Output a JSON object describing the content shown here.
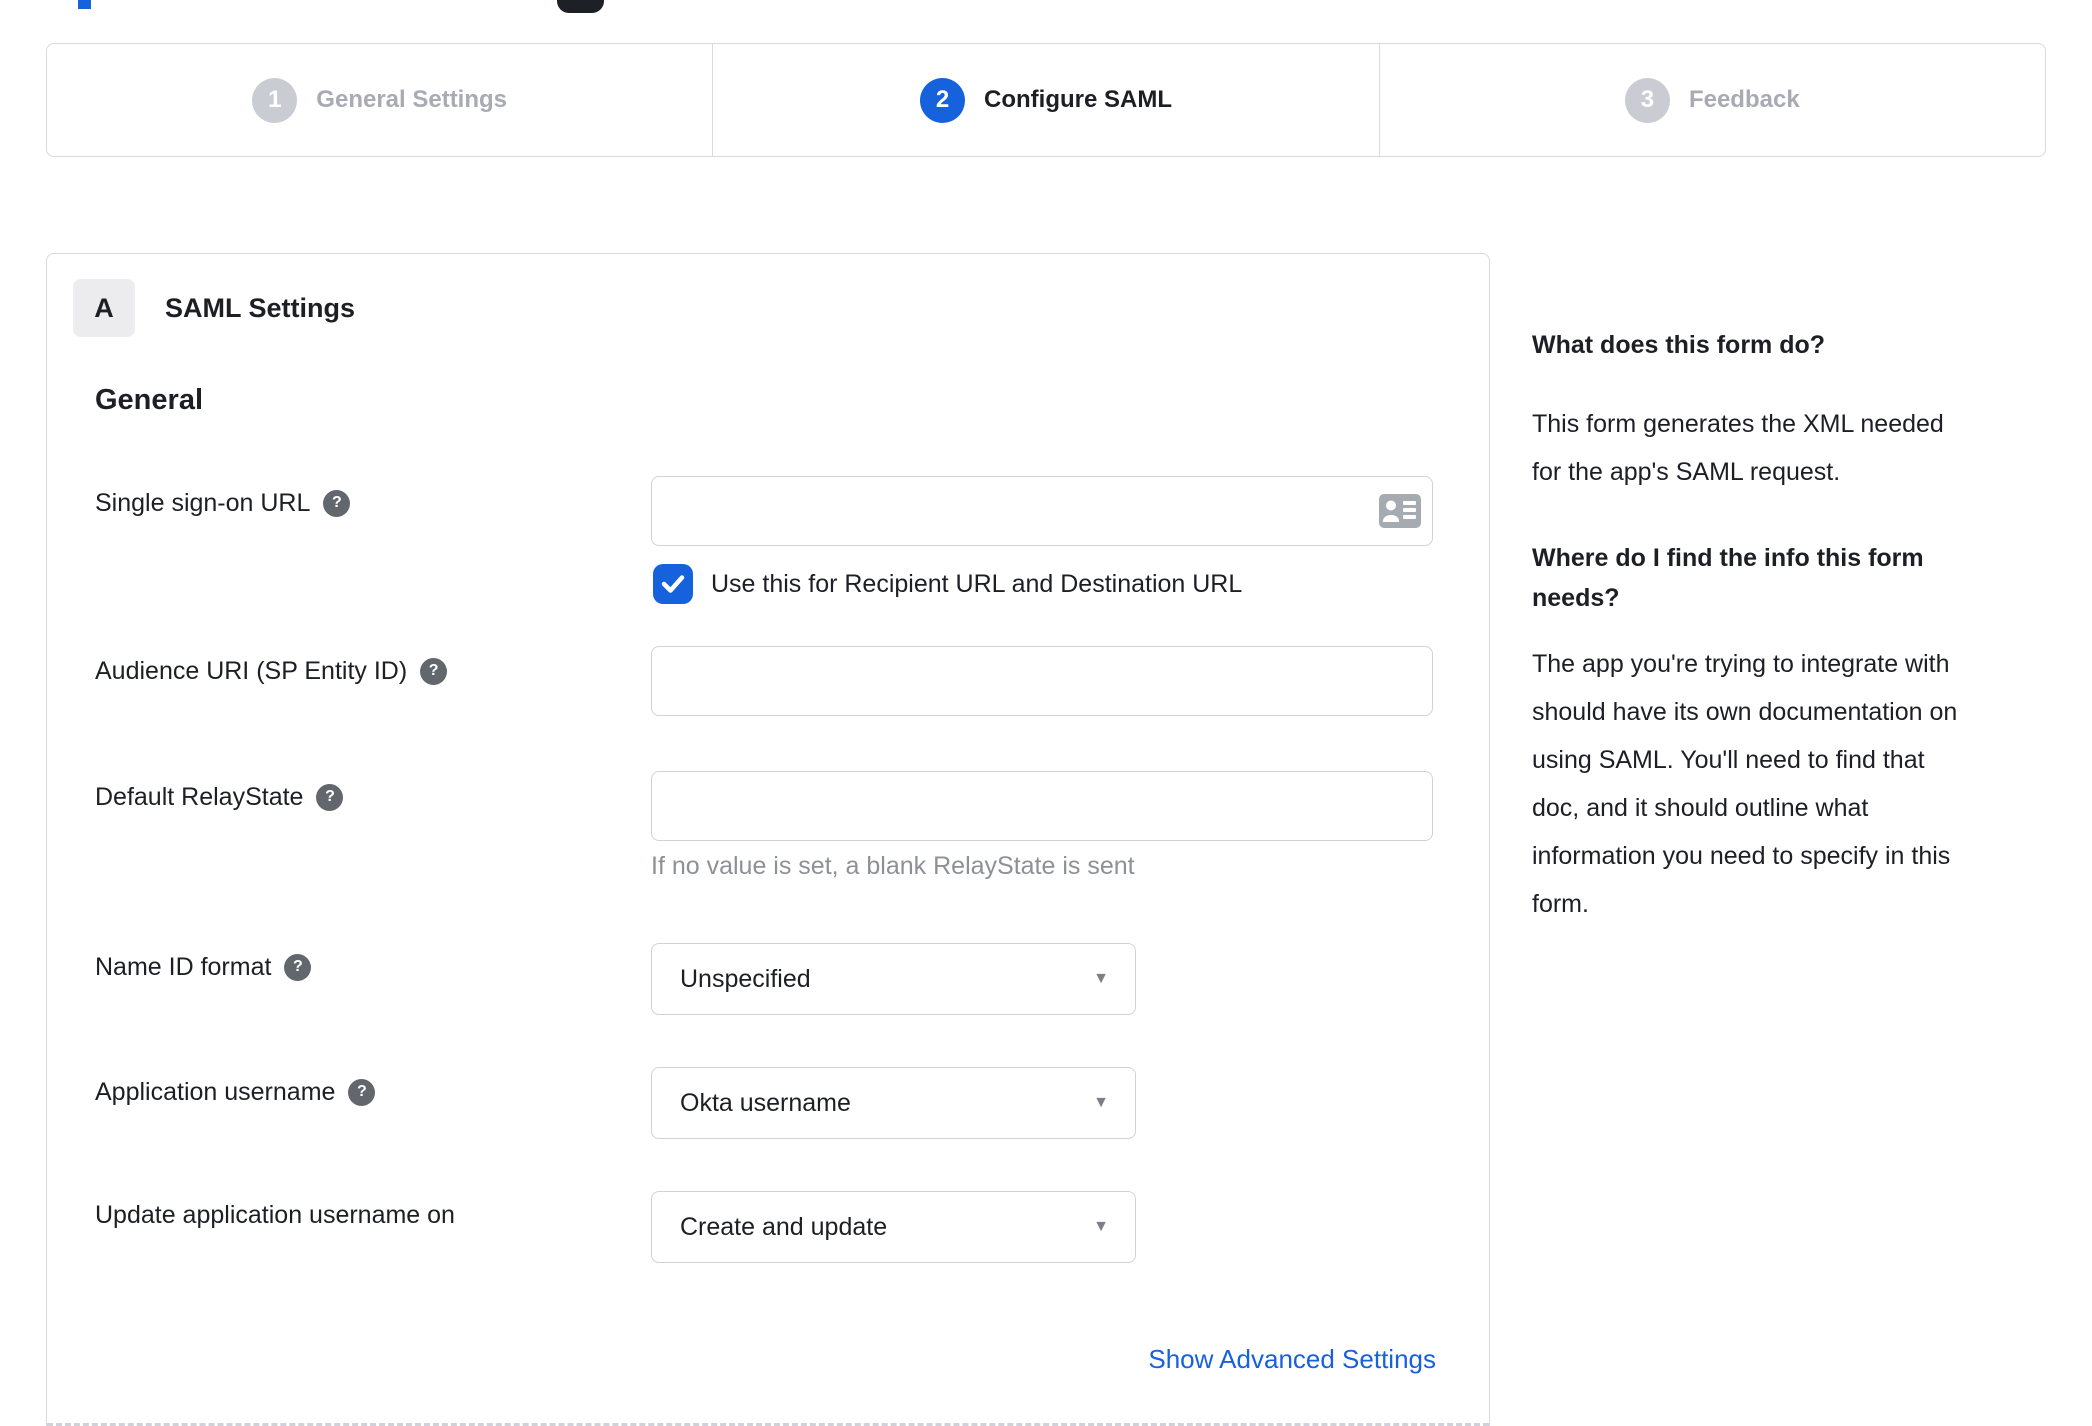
{
  "colors": {
    "accent_blue": "#1662dd",
    "link_blue": "#1661de",
    "inactive_gray": "#a8abb3",
    "panel_border": "#d9dade"
  },
  "stepper": {
    "steps": [
      {
        "number": "1",
        "label": "General Settings",
        "state": "inactive"
      },
      {
        "number": "2",
        "label": "Configure SAML",
        "state": "active"
      },
      {
        "number": "3",
        "label": "Feedback",
        "state": "inactive"
      }
    ]
  },
  "panel": {
    "badge": "A",
    "title": "SAML Settings",
    "section": "General",
    "sso": {
      "label": "Single sign-on URL",
      "value": "",
      "checkbox_label": "Use this for Recipient URL and Destination URL",
      "checkbox_checked": true
    },
    "audience": {
      "label": "Audience URI (SP Entity ID)",
      "value": ""
    },
    "relay": {
      "label": "Default RelayState",
      "value": "",
      "hint": "If no value is set, a blank RelayState is sent"
    },
    "name_id": {
      "label": "Name ID format",
      "value": "Unspecified"
    },
    "app_username": {
      "label": "Application username",
      "value": "Okta username"
    },
    "update_username": {
      "label": "Update application username on",
      "value": "Create and update"
    },
    "advanced_link": "Show Advanced Settings"
  },
  "sidebar": {
    "q1": "What does this form do?",
    "a1": "This form generates the XML needed\nfor the app's SAML request.",
    "q2": "Where do I find the info this form\nneeds?",
    "a2": "The app you're trying to integrate with\nshould have its own documentation on\nusing SAML. You'll need to find that\ndoc, and it should outline what\ninformation you need to specify in this\nform."
  }
}
